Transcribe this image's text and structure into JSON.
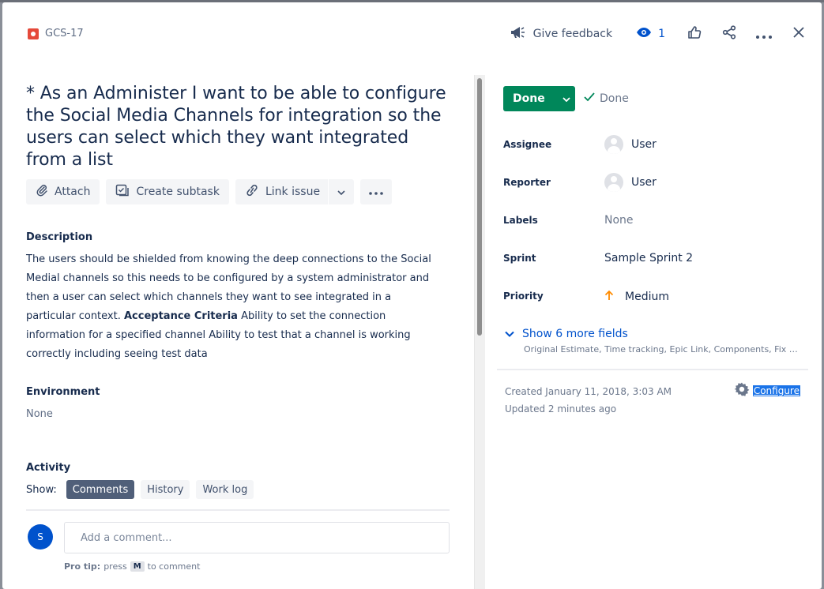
{
  "header": {
    "issue_key": "GCS-17",
    "give_feedback": "Give feedback",
    "watch_count": "1"
  },
  "issue": {
    "title": "* As an Administer I want to be able to configure the Social Media Channels for integration so the users can select which they want integrated from a list"
  },
  "toolbar": {
    "attach": "Attach",
    "create_subtask": "Create subtask",
    "link_issue": "Link issue"
  },
  "description": {
    "label": "Description",
    "text_before": "The users should be shielded from knowing the deep connections to the Social Medial channels so this needs to be configured by a system administrator and then a user can select which channels they want to see integrated in a particular context. ",
    "bold": "Acceptance Criteria",
    "text_after": " Ability to set the connection information for a specified channel Ability to test that a channel is working correctly including seeing test data"
  },
  "environment": {
    "label": "Environment",
    "value": "None"
  },
  "activity": {
    "label": "Activity",
    "show_label": "Show:",
    "tabs": [
      "Comments",
      "History",
      "Work log"
    ],
    "active_tab": "Comments",
    "avatar_initial": "S",
    "comment_placeholder": "Add a comment...",
    "protip_prefix": "Pro tip:",
    "protip_press": "press",
    "protip_key": "M",
    "protip_suffix": "to comment"
  },
  "status": {
    "button": "Done",
    "resolution": "Done",
    "button_color": "#00875a"
  },
  "fields": {
    "assignee_label": "Assignee",
    "assignee": "User",
    "reporter_label": "Reporter",
    "reporter": "User",
    "labels_label": "Labels",
    "labels": "None",
    "sprint_label": "Sprint",
    "sprint": "Sample Sprint 2",
    "priority_label": "Priority",
    "priority": "Medium",
    "priority_color": "#ff8b00"
  },
  "more_fields": {
    "title": "Show 6 more fields",
    "subtitle": "Original Estimate, Time tracking, Epic Link, Components, Fix versions, Affects versions"
  },
  "meta": {
    "created": "Created January 11, 2018, 3:03 AM",
    "updated": "Updated 2 minutes ago",
    "configure": "Configure"
  }
}
